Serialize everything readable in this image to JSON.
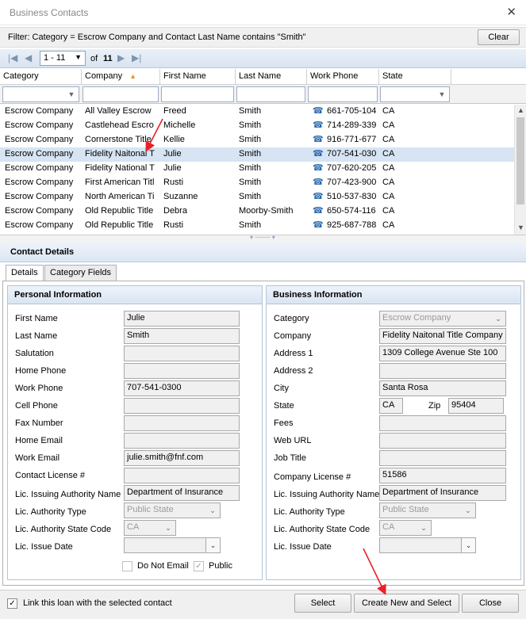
{
  "window": {
    "title": "Business Contacts",
    "close_glyph": "✕"
  },
  "filter": {
    "text": "Filter: Category = Escrow Company  and  Contact Last Name contains \"Smith\"",
    "clear_label": "Clear"
  },
  "pager": {
    "range": "1 - 11",
    "of_label": "of",
    "total": "11"
  },
  "grid": {
    "columns": [
      "Category",
      "Company",
      "First Name",
      "Last Name",
      "Work Phone",
      "State"
    ],
    "sort_indicator": "▲",
    "rows": [
      [
        "Escrow Company",
        "All Valley Escrow",
        "Freed",
        "Smith",
        "661-705-104",
        "CA"
      ],
      [
        "Escrow Company",
        "Castlehead Escro",
        "Michelle",
        "Smith",
        "714-289-339",
        "CA"
      ],
      [
        "Escrow Company",
        "Cornerstone Title",
        "Kellie",
        "Smith",
        "916-771-677",
        "CA"
      ],
      [
        "Escrow Company",
        "Fidelity Naitonal T",
        "Julie",
        "Smith",
        "707-541-030",
        "CA"
      ],
      [
        "Escrow Company",
        "Fidelity National T",
        "Julie",
        "Smith",
        "707-620-205",
        "CA"
      ],
      [
        "Escrow Company",
        "First American Titl",
        "Rusti",
        "Smith",
        "707-423-900",
        "CA"
      ],
      [
        "Escrow Company",
        "North American Ti",
        "Suzanne",
        "Smith",
        "510-537-830",
        "CA"
      ],
      [
        "Escrow Company",
        "Old Republic Title",
        "Debra",
        "Moorby-Smith",
        "650-574-116",
        "CA"
      ],
      [
        "Escrow Company",
        "Old Republic Title",
        "Rusti",
        "Smith",
        "925-687-788",
        "CA"
      ]
    ],
    "selected_index": 3
  },
  "details": {
    "section_title": "Contact Details",
    "tabs": [
      "Details",
      "Category Fields"
    ],
    "personal": {
      "title": "Personal Information",
      "labels": {
        "first_name": "First Name",
        "last_name": "Last Name",
        "salutation": "Salutation",
        "home_phone": "Home Phone",
        "work_phone": "Work Phone",
        "cell_phone": "Cell Phone",
        "fax": "Fax Number",
        "home_email": "Home Email",
        "work_email": "Work Email",
        "license": "Contact License #",
        "issuing": "Lic. Issuing Authority Name",
        "auth_type": "Lic. Authority Type",
        "auth_state": "Lic. Authority State Code",
        "issue_date": "Lic. Issue Date"
      },
      "values": {
        "first_name": "Julie",
        "last_name": "Smith",
        "salutation": "",
        "home_phone": "",
        "work_phone": "707-541-0300",
        "cell_phone": "",
        "fax": "",
        "home_email": "",
        "work_email": "julie.smith@fnf.com",
        "license": "",
        "issuing": "Department of Insurance",
        "auth_type": "Public State",
        "auth_state": "CA",
        "issue_date": ""
      },
      "do_not_email": "Do Not Email",
      "public": "Public"
    },
    "business": {
      "title": "Business Information",
      "labels": {
        "category": "Category",
        "company": "Company",
        "address1": "Address 1",
        "address2": "Address 2",
        "city": "City",
        "state": "State",
        "zip": "Zip",
        "fees": "Fees",
        "web_url": "Web URL",
        "job_title": "Job Title",
        "company_license": "Company License #",
        "issuing": "Lic. Issuing Authority Name",
        "auth_type": "Lic. Authority Type",
        "auth_state": "Lic. Authority State Code",
        "issue_date": "Lic. Issue Date"
      },
      "values": {
        "category": "Escrow Company",
        "company": "Fidelity Naitonal Title Company",
        "address1": "1309 College Avenue Ste 100",
        "address2": "",
        "city": "Santa Rosa",
        "state": "CA",
        "zip": "95404",
        "fees": "",
        "web_url": "",
        "job_title": "",
        "company_license": "51586",
        "issuing": "Department of Insurance",
        "auth_type": "Public State",
        "auth_state": "CA",
        "issue_date": ""
      }
    }
  },
  "footer": {
    "link_label": "Link this loan with the selected contact",
    "select_label": "Select",
    "create_label": "Create New and Select",
    "close_label": "Close"
  },
  "colors": {
    "annotation_arrow": "#e8202a",
    "selected_row": "#d6e4f3"
  }
}
